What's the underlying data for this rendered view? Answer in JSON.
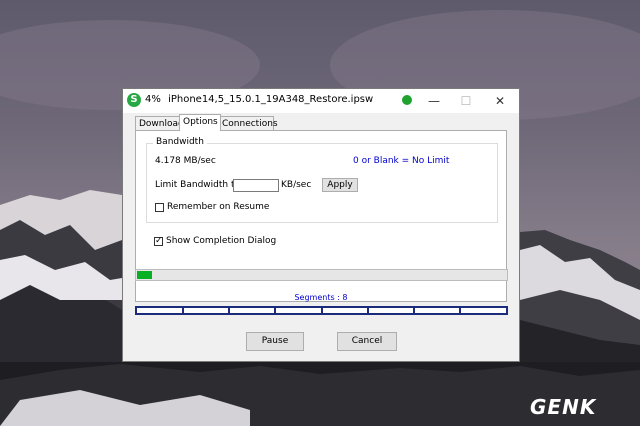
{
  "window": {
    "progress_percent_text": "4%",
    "file_name": "iPhone14,5_15.0.1_19A348_Restore.ipsw",
    "minimize_glyph": "—",
    "maximize_glyph": "☐",
    "close_glyph": "✕"
  },
  "tabs": [
    {
      "label": "Download",
      "active": false
    },
    {
      "label": "Options",
      "active": true
    },
    {
      "label": "Connections",
      "active": false
    }
  ],
  "bandwidth": {
    "group_label": "Bandwidth",
    "speed": "4.178 MB/sec",
    "hint": "0 or Blank = No Limit",
    "limit_label": "Limit Bandwidth to",
    "limit_value": "",
    "unit": "KB/sec",
    "apply_label": "Apply",
    "remember_label": "Remember on Resume",
    "remember_checked": false
  },
  "completion": {
    "label": "Show Completion Dialog",
    "checked": true
  },
  "progress": {
    "fraction": 0.04,
    "accent": "#06b025"
  },
  "segments": {
    "label": "Segments : 8",
    "count": 8
  },
  "buttons": {
    "pause": "Pause",
    "cancel": "Cancel"
  },
  "watermark": "GENK"
}
